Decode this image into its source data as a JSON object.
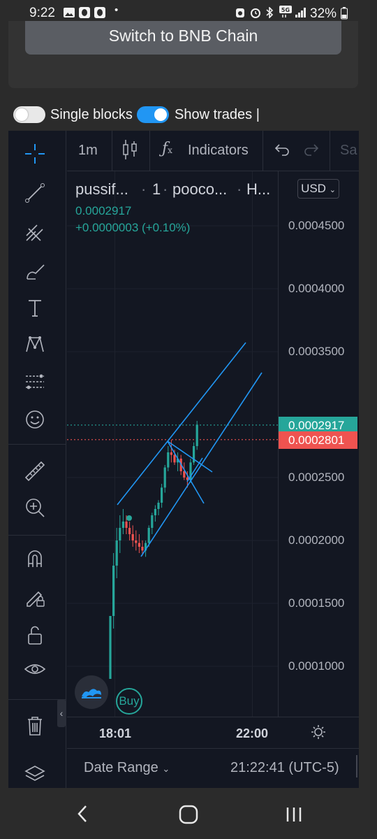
{
  "status_bar": {
    "time": "9:22",
    "dot": "•",
    "battery": "32%"
  },
  "top_card": {
    "switch_label": "Switch to BNB Chain"
  },
  "toggles": {
    "single_blocks": {
      "label": "Single blocks",
      "on": false
    },
    "show_trades": {
      "label": "Show trades |",
      "on": true
    }
  },
  "toolbar": {
    "interval": "1m",
    "indicators": "Indicators",
    "save": "Sa"
  },
  "legend": {
    "symbol": "pussif...",
    "interval": "1",
    "exchange": "pooco...",
    "type": "H...",
    "sep": "·",
    "currency": "USD",
    "last_price": "0.0002917",
    "change": "+0.0000003 (+0.10%)"
  },
  "price_axis": {
    "ticks": [
      "0.0004500",
      "0.0004000",
      "0.0003500",
      "0.0002500",
      "0.0002000",
      "0.0001500",
      "0.0001000"
    ],
    "last_price_tag": "0.0002917",
    "ref_price_tag": "0.0002801"
  },
  "time_axis": {
    "labels": [
      "18:01",
      "22:00"
    ]
  },
  "bottom_bar": {
    "date_range": "Date Range",
    "clock": "21:22:41 (UTC-5)"
  },
  "buy_badge": "Buy",
  "colors": {
    "up": "#26a69a",
    "down": "#ef5350",
    "drawing": "#2196f3",
    "accent_toggle": "#2196f3"
  },
  "chart_data": {
    "type": "candlestick",
    "ylim": [
      8e-05,
      0.00048
    ],
    "last": 0.0002917,
    "reference": 0.0002801,
    "candles": [
      [
        9e-05,
        0.00014,
        9e-05,
        0.00014
      ],
      [
        0.00014,
        0.00019,
        0.00013,
        0.00018
      ],
      [
        0.00018,
        0.00021,
        0.00017,
        0.0002
      ],
      [
        0.0002,
        0.00022,
        0.00019,
        0.00021
      ],
      [
        0.00021,
        0.000225,
        0.000205,
        0.000215
      ],
      [
        0.000215,
        0.00022,
        0.000205,
        0.00021
      ],
      [
        0.00021,
        0.000215,
        0.0002,
        0.000205
      ],
      [
        0.000205,
        0.000212,
        0.000195,
        0.0002
      ],
      [
        0.0002,
        0.000208,
        0.000192,
        0.000198
      ],
      [
        0.000198,
        0.000205,
        0.00019,
        0.000195
      ],
      [
        0.000195,
        0.0002,
        0.000188,
        0.000192
      ],
      [
        0.000192,
        0.0002,
        0.000187,
        0.000198
      ],
      [
        0.000198,
        0.000212,
        0.000195,
        0.00021
      ],
      [
        0.00021,
        0.000222,
        0.000205,
        0.00022
      ],
      [
        0.00022,
        0.000228,
        0.000215,
        0.000225
      ],
      [
        0.000225,
        0.000232,
        0.00022,
        0.00023
      ],
      [
        0.00023,
        0.000245,
        0.000226,
        0.000242
      ],
      [
        0.000242,
        0.00026,
        0.000238,
        0.000258
      ],
      [
        0.000258,
        0.000275,
        0.000255,
        0.00027
      ],
      [
        0.00027,
        0.00028,
        0.000262,
        0.000268
      ],
      [
        0.000268,
        0.000272,
        0.00026,
        0.000262
      ],
      [
        0.000262,
        0.00027,
        0.000255,
        0.000265
      ],
      [
        0.000265,
        0.000268,
        0.000252,
        0.000255
      ],
      [
        0.000255,
        0.000262,
        0.000248,
        0.00025
      ],
      [
        0.00025,
        0.000255,
        0.000242,
        0.000248
      ],
      [
        0.000248,
        0.000265,
        0.000246,
        0.000262
      ],
      [
        0.000262,
        0.000278,
        0.00026,
        0.000275
      ],
      [
        0.000275,
        0.000295,
        0.000272,
        0.000292
      ]
    ]
  }
}
